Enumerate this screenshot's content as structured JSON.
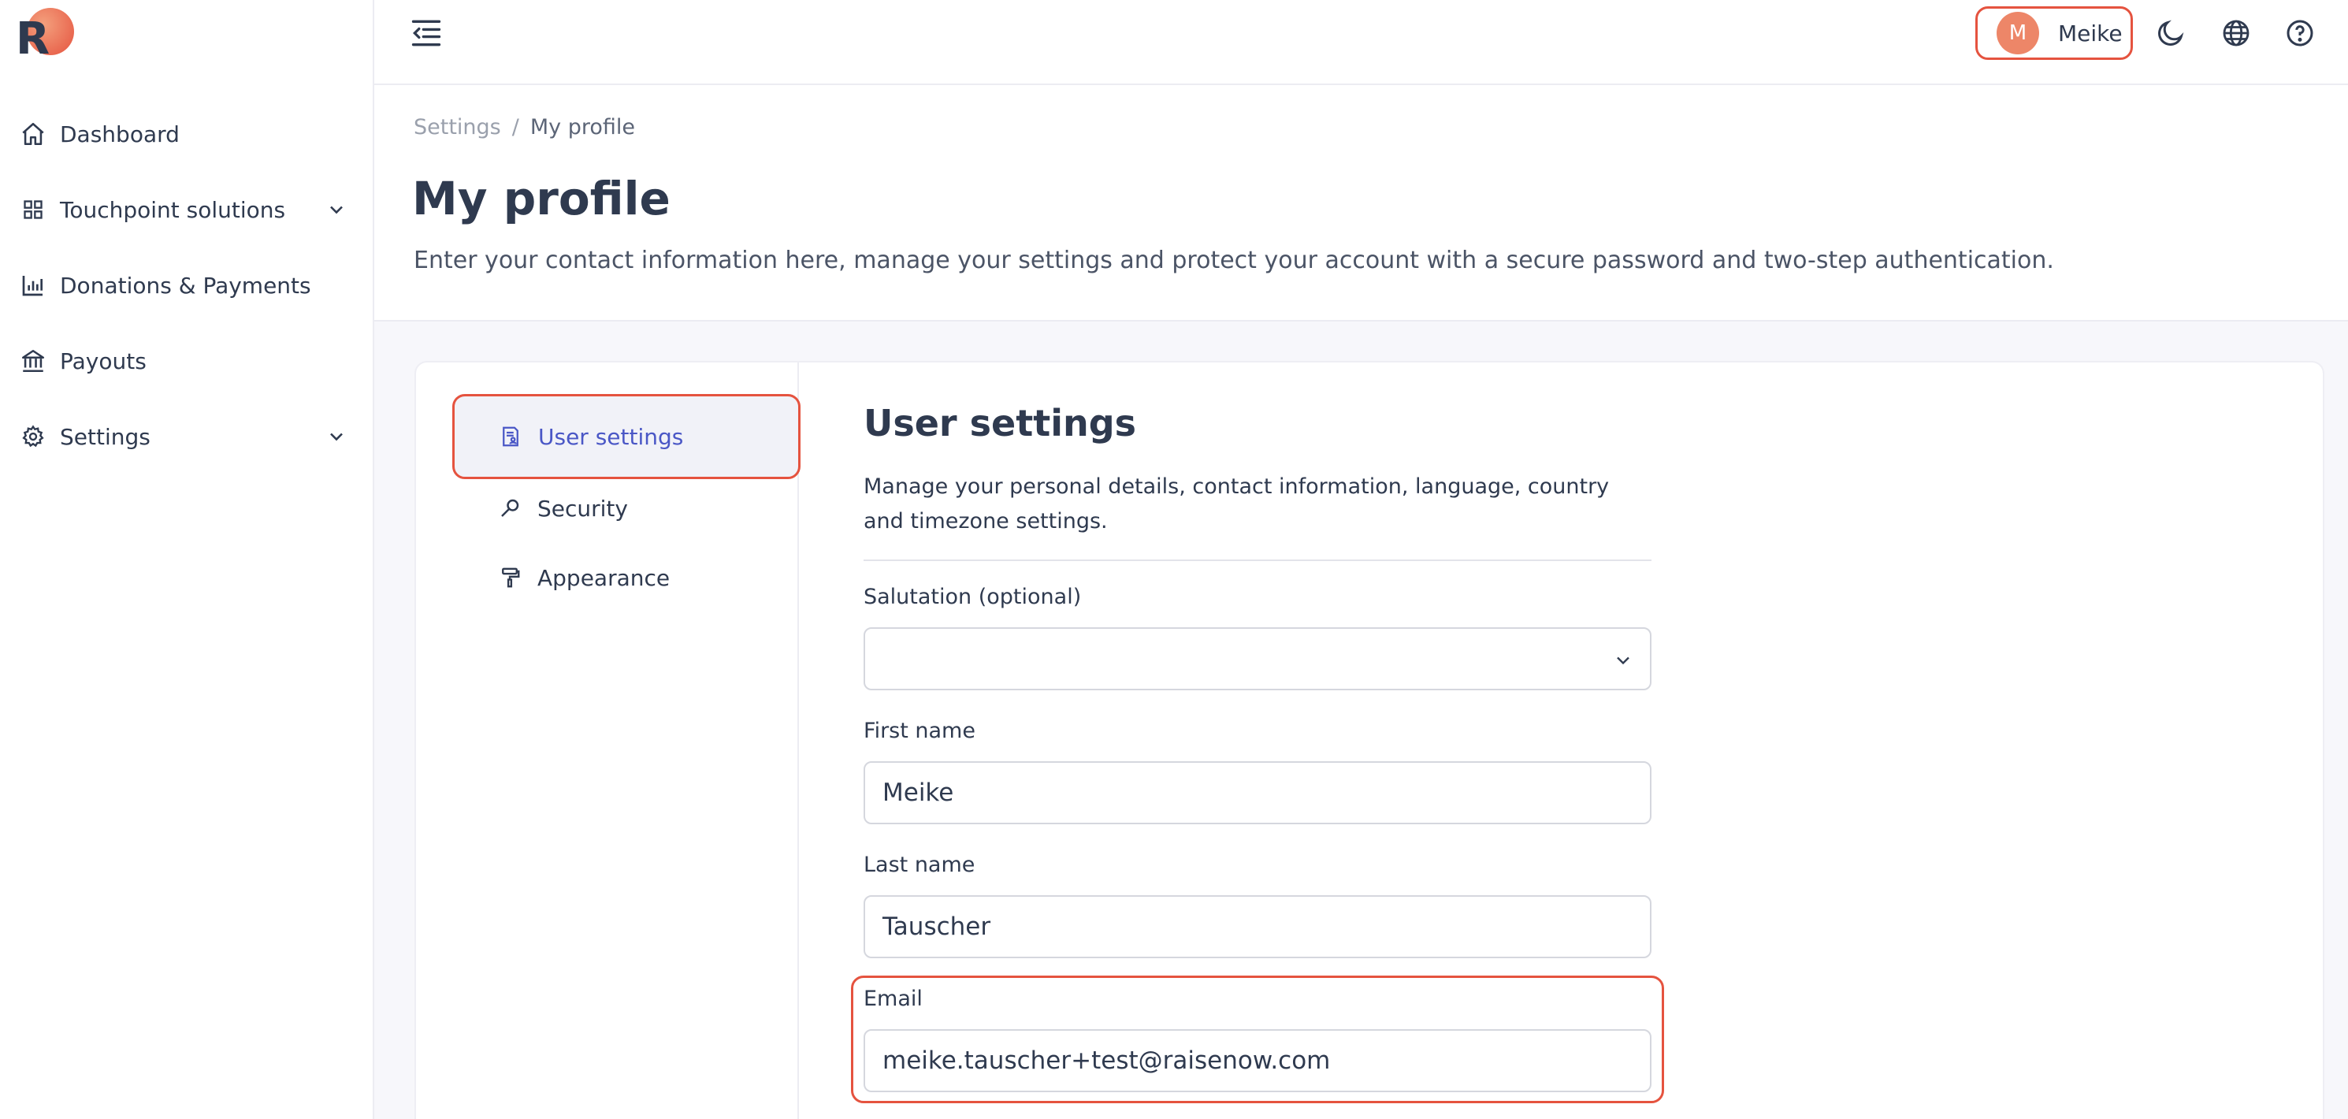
{
  "logo": {
    "letter": "R"
  },
  "sidebar": {
    "items": [
      {
        "label": "Dashboard",
        "icon": "home-icon"
      },
      {
        "label": "Touchpoint solutions",
        "icon": "grid-icon",
        "expandable": true
      },
      {
        "label": "Donations & Payments",
        "icon": "bar-chart-icon"
      },
      {
        "label": "Payouts",
        "icon": "bank-icon"
      },
      {
        "label": "Settings",
        "icon": "gear-icon",
        "expandable": true
      }
    ]
  },
  "topbar": {
    "user": {
      "initial": "M",
      "name": "Meike"
    },
    "icons": [
      "menu-collapse-icon",
      "moon-icon",
      "globe-icon",
      "help-icon"
    ]
  },
  "header": {
    "breadcrumb": {
      "parent": "Settings",
      "separator": "/",
      "current": "My profile"
    },
    "title": "My profile",
    "subtitle": "Enter your contact information here, manage your settings and protect your account with a secure password and two-step authentication."
  },
  "subnav": {
    "items": [
      {
        "label": "User settings",
        "icon": "user-document-icon",
        "active": true
      },
      {
        "label": "Security",
        "icon": "key-icon"
      },
      {
        "label": "Appearance",
        "icon": "paint-roller-icon"
      }
    ]
  },
  "user_settings": {
    "title": "User settings",
    "description": "Manage your personal details, contact information, language, country and timezone settings.",
    "fields": {
      "salutation": {
        "label": "Salutation (optional)",
        "value": ""
      },
      "first_name": {
        "label": "First name",
        "value": "Meike"
      },
      "last_name": {
        "label": "Last name",
        "value": "Tauscher"
      },
      "email": {
        "label": "Email",
        "value": "meike.tauscher+test@raisenow.com"
      }
    }
  },
  "colors": {
    "accent": "#4a57c6",
    "highlight": "#e5533f",
    "text": "#2f3a4f"
  }
}
